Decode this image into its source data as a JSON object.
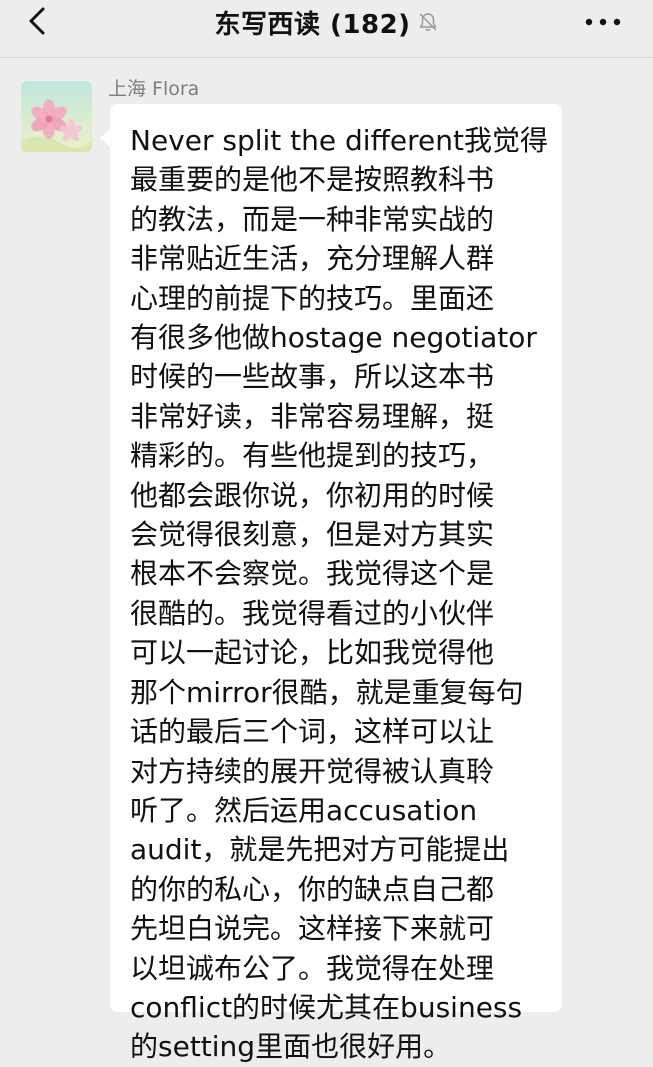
{
  "header": {
    "back_icon": "chevron-left-icon",
    "title": "东写西读 (182)",
    "mute_icon": "bell-slash-icon",
    "more_icon": "more-icon"
  },
  "message": {
    "sender": "上海 Flora",
    "avatar": "flower-photo-avatar",
    "lines": [
      "Never split the different我觉得",
      "最重要的是他不是按照教科书",
      "的教法，而是一种非常实战的",
      "非常贴近生活，充分理解人群",
      "心理的前提下的技巧。里面还",
      "有很多他做hostage negotiator",
      "时候的一些故事，所以这本书",
      "非常好读，非常容易理解，挺",
      "精彩的。有些他提到的技巧，",
      "他都会跟你说，你初用的时候",
      "会觉得很刻意，但是对方其实",
      "根本不会察觉。我觉得这个是",
      "很酷的。我觉得看过的小伙伴",
      "可以一起讨论，比如我觉得他",
      "那个mirror很酷，就是重复每句",
      "话的最后三个词，这样可以让",
      "对方持续的展开觉得被认真聆",
      "听了。然后运用accusation",
      "audit，就是先把对方可能提出",
      "的你的私心，你的缺点自己都",
      "先坦白说完。这样接下来就可",
      "以坦诚布公了。我觉得在处理",
      "conflict的时候尤其在business",
      "的setting里面也很好用。"
    ]
  },
  "colors": {
    "background": "#ededed",
    "bubble": "#ffffff",
    "text": "#111111",
    "sender": "#7d7d7d"
  }
}
